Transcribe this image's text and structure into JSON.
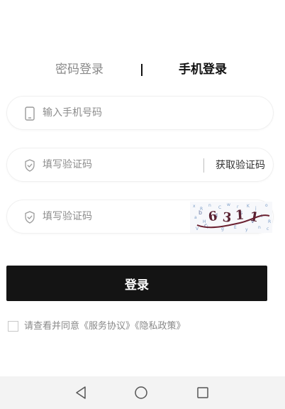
{
  "tabs": {
    "password_login": "密码登录",
    "phone_login": "手机登录",
    "active": "phone_login"
  },
  "phone_field": {
    "placeholder": "输入手机号码",
    "icon": "phone-icon"
  },
  "sms_field": {
    "placeholder": "填写验证码",
    "icon": "shield-icon",
    "get_code_label": "获取验证码"
  },
  "captcha_field": {
    "placeholder": "填写验证码",
    "icon": "shield-icon",
    "captcha_text": "6311"
  },
  "login_button": {
    "label": "登录"
  },
  "agreement": {
    "prefix": "请查看并同意",
    "service_link": "《服务协议》",
    "privacy_link": "《隐私政策》",
    "checked": false
  },
  "nav_bar": {
    "icons": [
      "back-icon",
      "home-icon",
      "recent-apps-icon"
    ]
  },
  "colors": {
    "background": "#ffffff",
    "button_bg": "#141414",
    "button_text": "#ffffff",
    "placeholder": "#8c8c8c",
    "active_tab": "#111111",
    "inactive_tab": "#8a8a8a",
    "captcha_stroke": "#7a2a3a",
    "nav_bar_bg": "#f3f3f3"
  }
}
